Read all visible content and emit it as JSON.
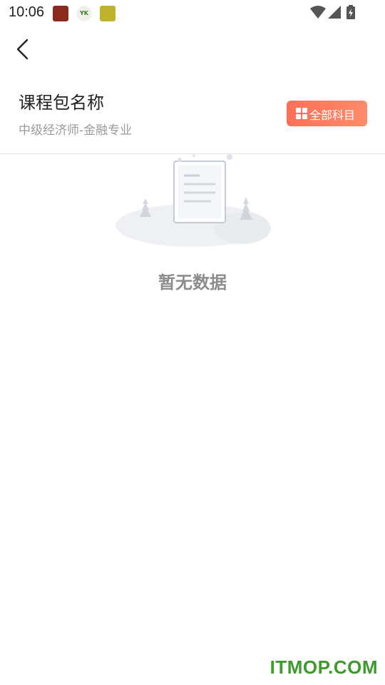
{
  "status_bar": {
    "time": "10:06",
    "notifications": [
      {
        "icon": "app-notification-icon-1",
        "text": ""
      },
      {
        "icon": "app-notification-icon-yk",
        "text": "YK"
      },
      {
        "icon": "app-notification-icon-3",
        "text": ""
      }
    ],
    "system_icons": [
      "wifi-icon",
      "cell-signal-icon",
      "battery-charging-icon"
    ]
  },
  "nav": {
    "back_icon": "chevron-left-icon"
  },
  "header": {
    "title": "课程包名称",
    "subtitle": "中级经济师-金融专业",
    "subject_button": {
      "label": "全部科目",
      "icon": "grid-icon",
      "color": "#ff7a5f"
    }
  },
  "empty_state": {
    "message": "暂无数据",
    "illustration": "empty-document-illustration"
  },
  "watermark": {
    "text": "ITMOP.COM",
    "color": "#3d9b2b"
  }
}
